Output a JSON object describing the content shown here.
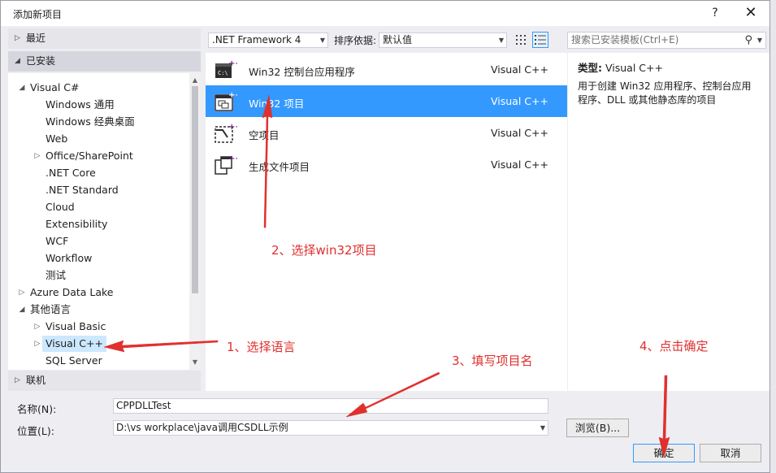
{
  "dialog": {
    "title": "添加新项目",
    "help": "?",
    "close": "✕"
  },
  "tree": {
    "recent": "最近",
    "installed": "已安装",
    "online": "联机",
    "items": [
      {
        "label": "Visual C#",
        "level": 0,
        "expander": "◢"
      },
      {
        "label": "Windows 通用",
        "level": 1,
        "expander": ""
      },
      {
        "label": "Windows 经典桌面",
        "level": 1,
        "expander": ""
      },
      {
        "label": "Web",
        "level": 1,
        "expander": ""
      },
      {
        "label": "Office/SharePoint",
        "level": 1,
        "expander": "▷"
      },
      {
        "label": ".NET Core",
        "level": 1,
        "expander": ""
      },
      {
        "label": ".NET Standard",
        "level": 1,
        "expander": ""
      },
      {
        "label": "Cloud",
        "level": 1,
        "expander": ""
      },
      {
        "label": "Extensibility",
        "level": 1,
        "expander": ""
      },
      {
        "label": "WCF",
        "level": 1,
        "expander": ""
      },
      {
        "label": "Workflow",
        "level": 1,
        "expander": ""
      },
      {
        "label": "测试",
        "level": 1,
        "expander": ""
      },
      {
        "label": "Azure Data Lake",
        "level": 0,
        "expander": "▷"
      },
      {
        "label": "其他语言",
        "level": 0,
        "expander": "◢"
      },
      {
        "label": "Visual Basic",
        "level": 1,
        "expander": "▷"
      },
      {
        "label": "Visual C++",
        "level": 1,
        "expander": "▷",
        "selected": true
      },
      {
        "label": "SQL Server",
        "level": 1,
        "expander": ""
      }
    ]
  },
  "toolbar": {
    "framework": ".NET Framework 4",
    "sort_label": "排序依据:",
    "sort_value": "默认值",
    "search_placeholder": "搜索已安装模板(Ctrl+E)"
  },
  "templates": [
    {
      "name": "Win32 控制台应用程序",
      "lang": "Visual C++",
      "icon": "console-app-icon",
      "selected": false
    },
    {
      "name": "Win32 项目",
      "lang": "Visual C++",
      "icon": "win32-project-icon",
      "selected": true
    },
    {
      "name": "空项目",
      "lang": "Visual C++",
      "icon": "empty-project-icon",
      "selected": false
    },
    {
      "name": "生成文件项目",
      "lang": "Visual C++",
      "icon": "makefile-project-icon",
      "selected": false
    }
  ],
  "description": {
    "type_label": "类型:",
    "type_value": "Visual C++",
    "text": "用于创建 Win32 应用程序、控制台应用程序、DLL 或其他静态库的项目"
  },
  "form": {
    "name_label": "名称(N):",
    "name_value": "CPPDLLTest",
    "location_label": "位置(L):",
    "location_value": "D:\\vs workplace\\java调用CSDLL示例",
    "browse": "浏览(B)...",
    "ok": "确定",
    "cancel": "取消"
  },
  "annotations": {
    "step1": "1、选择语言",
    "step2": "2、选择win32项目",
    "step3": "3、填写项目名",
    "step4": "4、点击确定"
  },
  "colors": {
    "accent": "#3399ff",
    "annotation": "#e0302e"
  }
}
